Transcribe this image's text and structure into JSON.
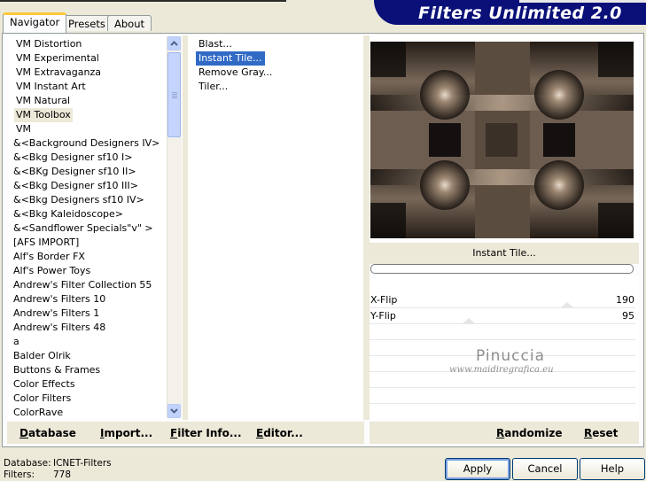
{
  "tabs": [
    {
      "label": "Navigator",
      "active": true
    },
    {
      "label": "Presets",
      "active": false
    },
    {
      "label": "About",
      "active": false
    }
  ],
  "banner": {
    "title": "Filters Unlimited 2.0",
    "color": "#0a1078"
  },
  "categories": [
    "VM Distortion",
    "VM Experimental",
    "VM Extravaganza",
    "VM Instant Art",
    "VM Natural",
    "VM Toolbox",
    "VM",
    "&<Background Designers IV>",
    "&<Bkg Designer sf10 I>",
    "&<BKg Designer sf10 II>",
    "&<Bkg Designer sf10 III>",
    "&<Bkg Designers sf10 IV>",
    "&<Bkg Kaleidoscope>",
    "&<Sandflower Specials\"v\" >",
    "[AFS IMPORT]",
    "Alf's Border FX",
    "Alf's Power Toys",
    "Andrew's Filter Collection 55",
    "Andrew's Filters 10",
    "Andrew's Filters 1",
    "Andrew's Filters 48",
    "a",
    "Balder Olrik",
    "Buttons & Frames",
    "Color Effects",
    "Color Filters",
    "ColorRave"
  ],
  "selected_category": "VM Toolbox",
  "filters": [
    "Blast...",
    "Instant Tile...",
    "Remove Gray...",
    "Tiler..."
  ],
  "selected_filter": "Instant Tile...",
  "preview": {
    "filter_name": "Instant Tile...",
    "progress": 0
  },
  "params": [
    {
      "name": "X-Flip",
      "value": "190",
      "level": 0.745
    },
    {
      "name": "Y-Flip",
      "value": "95",
      "level": 0.373
    }
  ],
  "watermark": {
    "name": "Pinuccia",
    "url": "www.maidiregrafica.eu"
  },
  "links": {
    "database": "Database",
    "import": "Import...",
    "filter_info": "Filter Info...",
    "editor": "Editor...",
    "randomize": "Randomize",
    "reset": "Reset"
  },
  "status": {
    "database_label": "Database:",
    "database_value": "ICNET-Filters",
    "filters_label": "Filters:",
    "filters_value": "778"
  },
  "buttons": {
    "apply": "Apply",
    "cancel": "Cancel",
    "help": "Help"
  },
  "colors": {
    "selection": "#316ac5",
    "tab_accent": "#ffc83c"
  }
}
